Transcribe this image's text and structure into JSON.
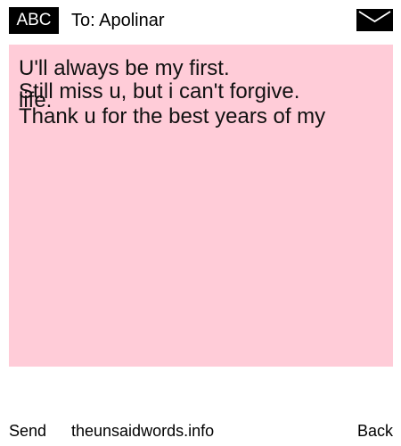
{
  "header": {
    "input_mode": "ABC",
    "recipient_line": "To: Apolinar"
  },
  "message": {
    "lines": [
      "U'll always be my first.",
      "Still miss u, but i can't forgive.",
      "life.",
      "Thank u for the best years of my"
    ],
    "card_color": "#ffccd8"
  },
  "footer": {
    "send_label": "Send",
    "site_label": "theunsaidwords.info",
    "back_label": "Back"
  },
  "icons": {
    "envelope": "envelope-icon"
  }
}
